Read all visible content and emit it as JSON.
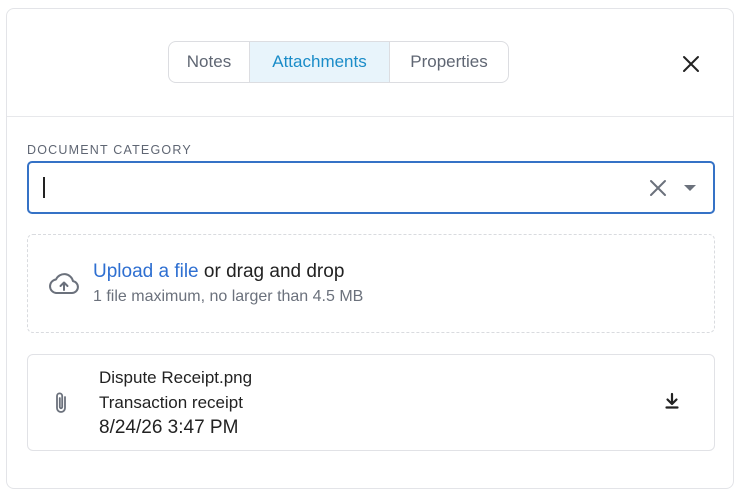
{
  "tabs": [
    {
      "label": "Notes",
      "active": false
    },
    {
      "label": "Attachments",
      "active": true
    },
    {
      "label": "Properties",
      "active": false
    }
  ],
  "icons": {
    "close": "close-icon",
    "clear": "clear-icon",
    "dropdown": "dropdown-arrow-icon",
    "upload": "cloud-upload-icon",
    "attachment": "paperclip-icon",
    "download": "download-icon"
  },
  "colors": {
    "active_tab_text": "#1a8cc8",
    "active_tab_bg": "#e8f4fb",
    "focus_border": "#3572c6",
    "link": "#2e6fd1"
  },
  "category": {
    "label": "DOCUMENT CATEGORY",
    "value": "",
    "placeholder": ""
  },
  "upload": {
    "link_text": "Upload a file",
    "rest_text": " or drag and drop",
    "hint": "1 file maximum, no larger than 4.5 MB"
  },
  "attachment": {
    "name": "Dispute Receipt.png",
    "description": "Transaction receipt",
    "timestamp": "8/24/26 3:47 PM"
  }
}
